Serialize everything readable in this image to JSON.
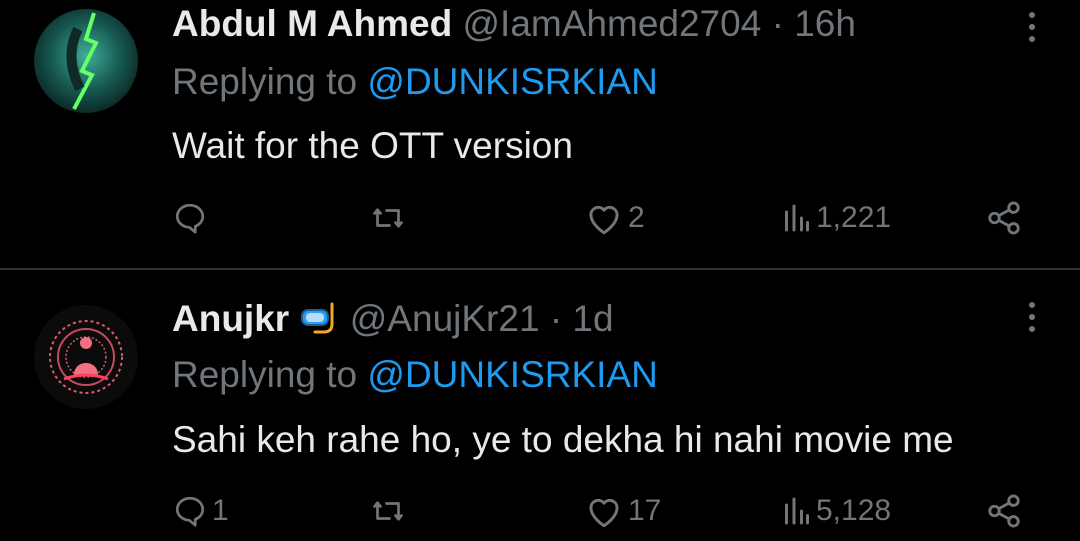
{
  "tweets": [
    {
      "author_name": "Abdul M Ahmed",
      "handle": "@IamAhmed2704",
      "separator": "·",
      "time": "16h",
      "replying_prefix": "Replying to",
      "replying_to": "@DUNKISRKIAN",
      "text": "Wait for the OTT version",
      "reply_count": "",
      "retweet_count": "",
      "like_count": "2",
      "view_count": "1,221",
      "avatar_icon": "green-lightning-avatar"
    },
    {
      "author_name": "Anujkr",
      "author_emoji_icon": "snorkel-mask-emoji",
      "handle": "@AnujKr21",
      "separator": "·",
      "time": "1d",
      "replying_prefix": "Replying to",
      "replying_to": "@DUNKISRKIAN",
      "text": "Sahi keh rahe ho, ye to dekha hi nahi movie me",
      "reply_count": "1",
      "retweet_count": "",
      "like_count": "17",
      "view_count": "5,128",
      "avatar_icon": "red-mandala-buddha-avatar"
    }
  ],
  "colors": {
    "background": "#000000",
    "text_primary": "#e7e9ea",
    "text_secondary": "#71767b",
    "link": "#1d9bf0",
    "divider": "#2f3336"
  }
}
